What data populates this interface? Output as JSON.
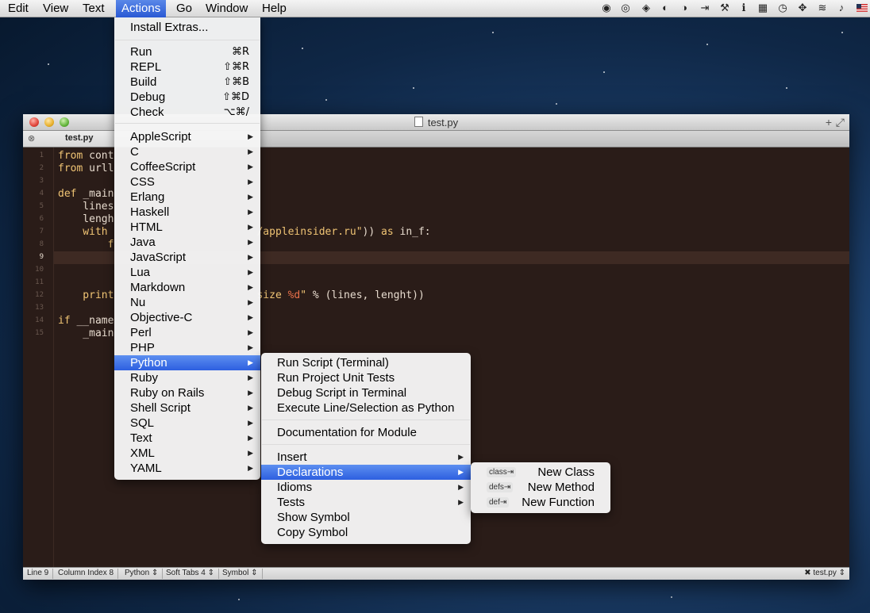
{
  "menubar": {
    "items": [
      "Edit",
      "View",
      "Text",
      "Actions",
      "Go",
      "Window",
      "Help"
    ],
    "active": "Actions",
    "tray_icons": [
      "spiral-icon",
      "swirl-icon",
      "dropbox-icon",
      "leaf-icon",
      "half-circle-icon",
      "tab-key-icon",
      "pickaxe-icon",
      "info-icon",
      "grid-icon",
      "time-machine-icon",
      "move-icon",
      "wifi-icon",
      "volume-icon",
      "flag-icon"
    ]
  },
  "window": {
    "title": "test.py",
    "tab_label": "test.py"
  },
  "code_lines": [
    {
      "n": "1",
      "parts": [
        [
          "kw",
          "from "
        ],
        [
          "t",
          "cont"
        ]
      ]
    },
    {
      "n": "2",
      "parts": [
        [
          "kw",
          "from "
        ],
        [
          "t",
          "urll"
        ]
      ]
    },
    {
      "n": "3",
      "parts": []
    },
    {
      "n": "4",
      "parts": [
        [
          "kw",
          "def "
        ],
        [
          "t",
          "_main"
        ]
      ]
    },
    {
      "n": "5",
      "parts": [
        [
          "t",
          "    lines"
        ]
      ]
    },
    {
      "n": "6",
      "parts": [
        [
          "t",
          "    lengh"
        ]
      ]
    },
    {
      "n": "7",
      "parts": [
        [
          "kw",
          "    with "
        ],
        [
          "t",
          "                       "
        ],
        [
          "str",
          "/appleinsider.ru\""
        ],
        [
          "t",
          ")) "
        ],
        [
          "kw",
          "as"
        ],
        [
          "t",
          " in_f:"
        ]
      ]
    },
    {
      "n": "8",
      "parts": [
        [
          "kw",
          "        f"
        ]
      ]
    },
    {
      "n": "9",
      "parts": []
    },
    {
      "n": "10",
      "parts": []
    },
    {
      "n": "11",
      "parts": []
    },
    {
      "n": "12",
      "parts": [
        [
          "kw",
          "    print"
        ],
        [
          "t",
          "                       "
        ],
        [
          "str",
          "size "
        ],
        [
          "fmt",
          "%d"
        ],
        [
          "str",
          "\""
        ],
        [
          "t",
          " % (lines, lenght))"
        ]
      ]
    },
    {
      "n": "13",
      "parts": []
    },
    {
      "n": "14",
      "parts": [
        [
          "kw",
          "if "
        ],
        [
          "t",
          "__name"
        ]
      ]
    },
    {
      "n": "15",
      "parts": [
        [
          "t",
          "    _main"
        ]
      ]
    }
  ],
  "current_line": "9",
  "statusbar": {
    "line": "Line 9",
    "column": "Column Index 8",
    "language": "Python",
    "tabs": "Soft Tabs 4",
    "symbol": "Symbol",
    "file": "test.py"
  },
  "actions_menu": {
    "top": [
      {
        "label": "Install Extras..."
      }
    ],
    "run": [
      {
        "label": "Run",
        "shortcut": "⌘R"
      },
      {
        "label": "REPL",
        "shortcut": "⇧⌘R"
      },
      {
        "label": "Build",
        "shortcut": "⇧⌘B"
      },
      {
        "label": "Debug",
        "shortcut": "⇧⌘D"
      },
      {
        "label": "Check",
        "shortcut": "⌥⌘/"
      }
    ],
    "languages": [
      "AppleScript",
      "C",
      "CoffeeScript",
      "CSS",
      "Erlang",
      "Haskell",
      "HTML",
      "Java",
      "JavaScript",
      "Lua",
      "Markdown",
      "Nu",
      "Objective-C",
      "Perl",
      "PHP",
      "Python",
      "Ruby",
      "Ruby on Rails",
      "Shell Script",
      "SQL",
      "Text",
      "XML",
      "YAML"
    ],
    "highlighted": "Python"
  },
  "python_menu": {
    "group1": [
      "Run Script (Terminal)",
      "Run Project Unit Tests",
      "Debug Script in Terminal",
      "Execute Line/Selection as Python"
    ],
    "group2": [
      "Documentation for Module"
    ],
    "group3": [
      {
        "label": "Insert",
        "submenu": true
      },
      {
        "label": "Declarations",
        "submenu": true
      },
      {
        "label": "Idioms",
        "submenu": true
      },
      {
        "label": "Tests",
        "submenu": true
      },
      {
        "label": "Show Symbol",
        "submenu": false
      },
      {
        "label": "Copy Symbol",
        "submenu": false
      }
    ],
    "highlighted": "Declarations"
  },
  "declarations_menu": [
    {
      "trigger": "class⇥",
      "label": "New Class"
    },
    {
      "trigger": "defs⇥",
      "label": "New Method"
    },
    {
      "trigger": "def⇥",
      "label": "New Function"
    }
  ]
}
